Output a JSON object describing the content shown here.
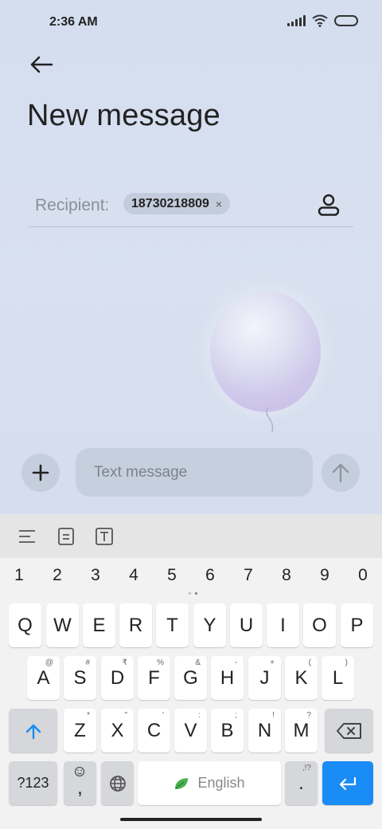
{
  "status_bar": {
    "time": "2:36 AM"
  },
  "header": {
    "title": "New message"
  },
  "recipient": {
    "label": "Recipient:",
    "chip_number": "18730218809",
    "chip_remove": "×"
  },
  "composer": {
    "placeholder": "Text message"
  },
  "keyboard": {
    "number_row": [
      "1",
      "2",
      "3",
      "4",
      "5",
      "6",
      "7",
      "8",
      "9",
      "0"
    ],
    "row1": [
      {
        "label": "Q"
      },
      {
        "label": "W"
      },
      {
        "label": "E"
      },
      {
        "label": "R"
      },
      {
        "label": "T"
      },
      {
        "label": "Y"
      },
      {
        "label": "U"
      },
      {
        "label": "I"
      },
      {
        "label": "O"
      },
      {
        "label": "P"
      }
    ],
    "row2": [
      {
        "label": "A",
        "hint": "@"
      },
      {
        "label": "S",
        "hint": "#"
      },
      {
        "label": "D",
        "hint": "₹"
      },
      {
        "label": "F",
        "hint": "%"
      },
      {
        "label": "G",
        "hint": "&"
      },
      {
        "label": "H",
        "hint": "-"
      },
      {
        "label": "J",
        "hint": "+"
      },
      {
        "label": "K",
        "hint": "("
      },
      {
        "label": "L",
        "hint": ")"
      }
    ],
    "row3": [
      {
        "label": "Z",
        "hint": "*"
      },
      {
        "label": "X",
        "hint": "\""
      },
      {
        "label": "C",
        "hint": "'"
      },
      {
        "label": "V",
        "hint": ":"
      },
      {
        "label": "B",
        "hint": ";"
      },
      {
        "label": "N",
        "hint": "!"
      },
      {
        "label": "M",
        "hint": "?"
      }
    ],
    "symbols_key": "?123",
    "comma_key": ",",
    "space_label": "English",
    "period_key": ".",
    "period_hint": ",!?"
  },
  "colors": {
    "accent": "#1a8cf5",
    "background": "#d6dff0",
    "keyboard": "#f2f2f3"
  },
  "icons": [
    "back-arrow-icon",
    "contact-icon",
    "plus-icon",
    "send-arrow-icon",
    "align-icon",
    "clipboard-icon",
    "text-box-icon",
    "shift-icon",
    "backspace-icon",
    "emoji-icon",
    "globe-icon",
    "leaf-icon",
    "enter-icon"
  ]
}
